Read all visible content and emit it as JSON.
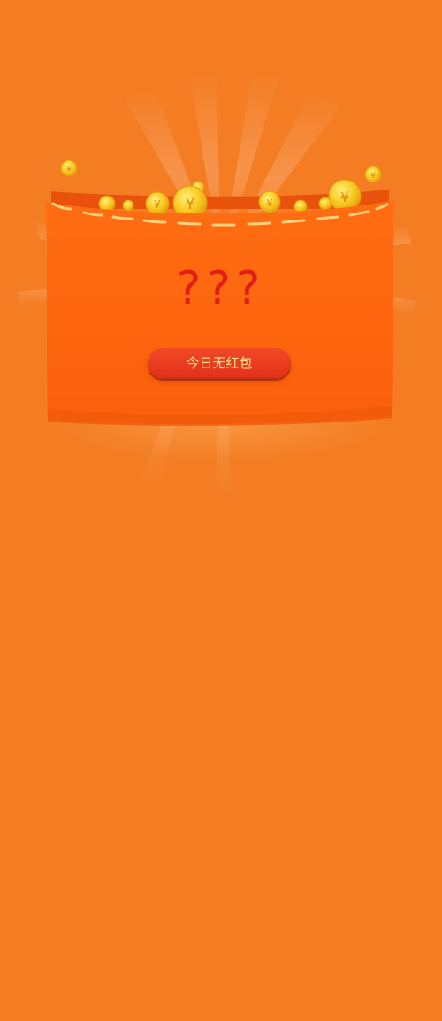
{
  "envelope": {
    "title_marks": "???",
    "button_label": "今日无红包",
    "coin_symbol": "¥"
  },
  "colors": {
    "background": "#f47d24",
    "envelope": "#fe650f",
    "question": "#e21f14",
    "button": "#e63a1c",
    "button_text": "#ffe08a",
    "coin": "#f6c324"
  },
  "icons": {
    "coin": "yuan-coin-icon",
    "stitch": "stitch-line"
  }
}
